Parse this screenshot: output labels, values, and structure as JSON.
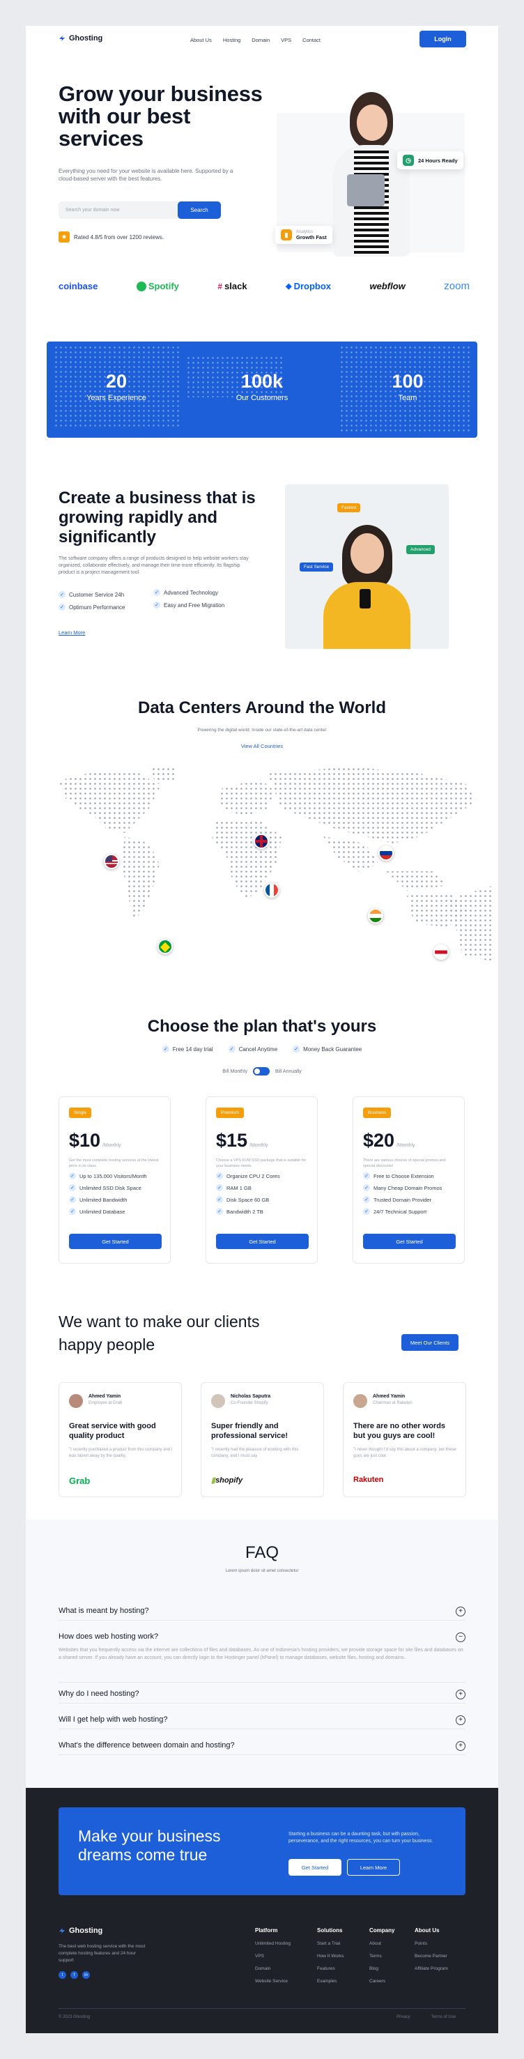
{
  "brand": {
    "name": "Ghosting"
  },
  "nav": {
    "links": [
      "About Us",
      "Hosting",
      "Domain",
      "VPS",
      "Contact"
    ],
    "login": "Login"
  },
  "hero": {
    "title": "Grow your business with our best services",
    "subtitle": "Everything you need for your website is available here. Supported by a cloud-based server with the best features.",
    "search_placeholder": "Search your domain now",
    "search_button": "Search",
    "rating": "Rated 4.8/5 from over 1200 reviews.",
    "chip_ready": "24 Hours Ready",
    "chip_growth_label": "Analytics",
    "chip_growth": "Growth Fast"
  },
  "partners": [
    "coinbase",
    "Spotify",
    "slack",
    "Dropbox",
    "webflow",
    "zoom"
  ],
  "stats": [
    {
      "value": "20",
      "label": "Years Experience"
    },
    {
      "value": "100k",
      "label": "Our Customers"
    },
    {
      "value": "100",
      "label": "Team"
    }
  ],
  "grow": {
    "title": "Create a business that is growing rapidly and significantly",
    "body": "The software company offers a range of products designed to help website workers stay organized, collaborate effectively, and manage their time more efficiently. Its flagship product is a project management tool.",
    "features": [
      "Customer Service 24h",
      "Advanced Technology",
      "Optimum Performance",
      "Easy and Free Migration"
    ],
    "link": "Learn More",
    "tags": [
      "Fastest",
      "Advanced",
      "Fast Service"
    ]
  },
  "datacenters": {
    "title": "Data Centers Around the World",
    "subtitle": "Powering the digital world: Inside our state-of-the-art data center",
    "link": "View All Countries"
  },
  "pricing": {
    "title": "Choose the plan that's yours",
    "perks": [
      "Free 14 day trial",
      "Cancel Anytime",
      "Money Back Guarantee"
    ],
    "toggle": [
      "Bill Monthly",
      "Bill Annually"
    ],
    "plans": [
      {
        "badge": "Single",
        "price": "$10",
        "period": "/Monthly",
        "desc": "Get the most complete hosting services at the lowest price in its class.",
        "features": [
          "Up to 135.000 Visitors/Month",
          "Unlimited SSD Disk Space",
          "Unlimited Bandwidth",
          "Unlimited Database"
        ],
        "button": "Get Started"
      },
      {
        "badge": "Premium",
        "price": "$15",
        "period": "/Monthly",
        "desc": "Choose a VPS KVM SSD package that is suitable for your business needs.",
        "features": [
          "Organize CPU 2 Cores",
          "RAM 1 GB",
          "Disk Space 60 GB",
          "Bandwidth 2 TB"
        ],
        "button": "Get Started"
      },
      {
        "badge": "Business",
        "price": "$20",
        "period": "/Monthly",
        "desc": "There are various choices of special promos and special discounts!",
        "features": [
          "Free to Choose Extension",
          "Many Cheap Domain Promos",
          "Trusted Domain Provider",
          "24/7 Technical Support"
        ],
        "button": "Get Started"
      }
    ]
  },
  "testimonials": {
    "title": "We want to make our clients happy people",
    "button": "Meet Our Clients",
    "items": [
      {
        "name": "Ahmed Yamin",
        "role": "Employee at Grab",
        "title": "Great service with good quality product",
        "body": "\"I recently purchased a product from this company and I was blown away by the quality.",
        "logo": "Grab"
      },
      {
        "name": "Nicholas Saputra",
        "role": "Co-Founder Shopify",
        "title": "Super friendly and professional service!",
        "body": "\"I recently had the pleasure of working with this company, and I must say",
        "logo": "shopify"
      },
      {
        "name": "Ahmed Yamin",
        "role": "Chairman at Rakuten",
        "title": "There are no other words but you guys are cool!",
        "body": "\"I never thought I'd say this about a company, but these guys are just cool.",
        "logo": "Rakuten"
      }
    ]
  },
  "faq": {
    "title": "FAQ",
    "subtitle": "Lorem ipsum dolor sit amet consectetur",
    "items": [
      {
        "q": "What is meant by hosting?",
        "a": ""
      },
      {
        "q": "How does web hosting work?",
        "a": "Websites that you frequently access via the internet are collections of files and databases. As one of Indonesia's hosting providers, we provide storage space for site files and databases on a shared server. If you already have an account, you can directly login to the Hostinger panel (hPanel) to manage databases, website files, hosting and domains."
      },
      {
        "q": "Why do I need hosting?",
        "a": ""
      },
      {
        "q": "Will I get help with web hosting?",
        "a": ""
      },
      {
        "q": "What's the difference between domain and hosting?",
        "a": ""
      }
    ]
  },
  "cta": {
    "title": "Make your business dreams come true",
    "body": "Starting a business can be a daunting task, but with passion, perseverance, and the right resources, you can turn your business.",
    "primary": "Get Started",
    "secondary": "Learn More"
  },
  "footer": {
    "tagline": "The best web hosting service with the most complete hosting features and 24 hour support",
    "columns": [
      {
        "title": "Platform",
        "links": [
          "Unlimited Hosting",
          "VPS",
          "Domain",
          "Website Service"
        ]
      },
      {
        "title": "Solutions",
        "links": [
          "Start a Trial",
          "How It Works",
          "Features",
          "Examples"
        ]
      },
      {
        "title": "Company",
        "links": [
          "About",
          "Terms",
          "Blog",
          "Careers"
        ]
      },
      {
        "title": "About Us",
        "links": [
          "Points",
          "Become Partner",
          "Affiliate Program"
        ]
      }
    ],
    "copyright": "© 2023 Ghosting",
    "legal": [
      "Privacy",
      "Terms of Use"
    ]
  },
  "colors": {
    "accent": "#1d5fd8",
    "orange": "#f59e0b",
    "green": "#22a06b",
    "dark": "#1e2127"
  }
}
